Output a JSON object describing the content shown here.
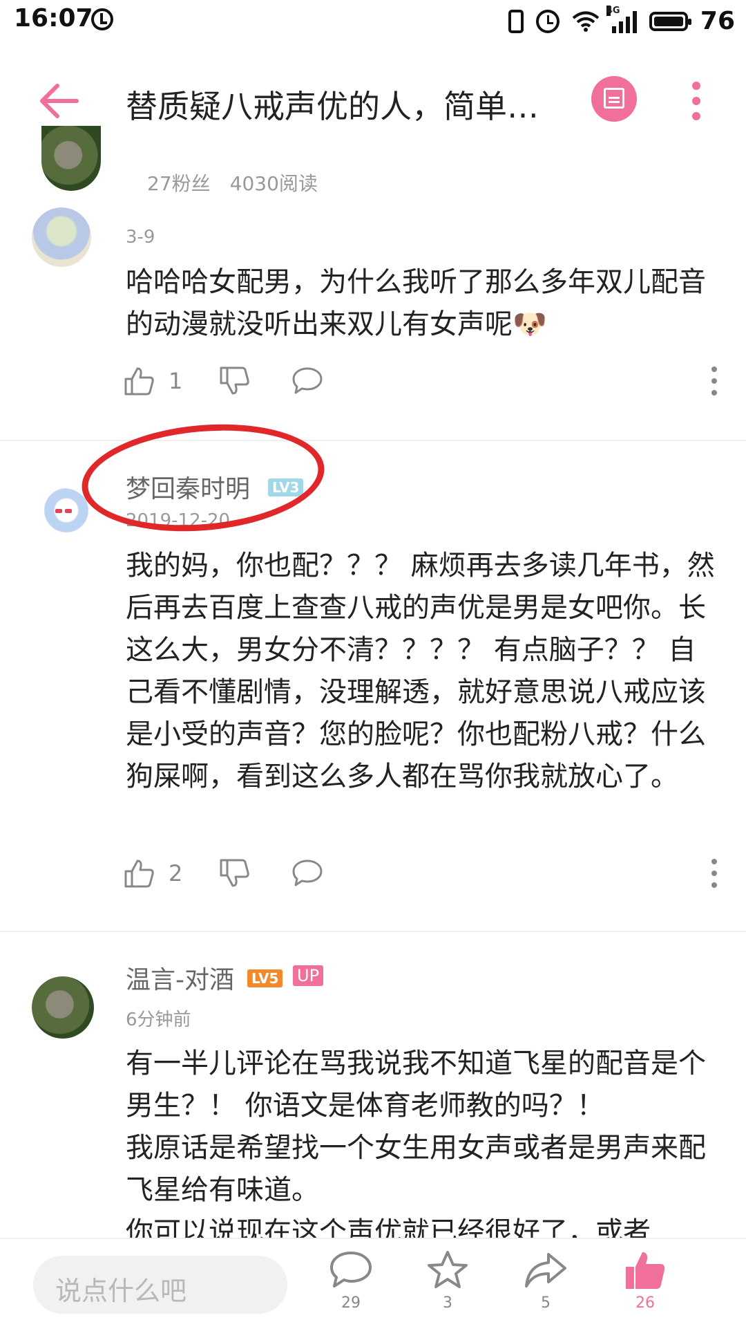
{
  "status_bar": {
    "time": "16:07",
    "network": "4G",
    "battery": "76"
  },
  "header": {
    "title": "替质疑八戒声优的人，简单…"
  },
  "author_info": {
    "fans": "27粉丝",
    "reads": "4030阅读"
  },
  "comments": [
    {
      "date": "3-9",
      "text": "哈哈哈女配男，为什么我听了那么多年双儿配音的动漫就没听出来双儿有女声呢🐶",
      "likes": "1"
    },
    {
      "name": "梦回秦时明",
      "level": "LV3",
      "date": "2019-12-20",
      "text": "我的妈，你也配？？？ 麻烦再去多读几年书，然后再去百度上查查八戒的声优是男是女吧你。长这么大，男女分不清？？？？ 有点脑子？？ 自己看不懂剧情，没理解透，就好意思说八戒应该是小受的声音？您的脸呢？你也配粉八戒？什么狗屎啊，看到这么多人都在骂你我就放心了。",
      "likes": "2"
    },
    {
      "name": "温言-对酒",
      "level": "LV5",
      "tag": "UP",
      "date": "6分钟前",
      "text": "有一半儿评论在骂我说我不知道飞星的配音是个男生？！ 你语文是体育老师教的吗？！\n我原话是希望找一个女生用女声或者是男声来配飞星给有味道。\n你可以说现在这个声优就已经很好了，或者"
    }
  ],
  "bottom_bar": {
    "input_placeholder": "说点什么吧",
    "comments": "29",
    "favorites": "3",
    "shares": "5",
    "likes": "26"
  },
  "colors": {
    "accent": "#f06f9b",
    "annotation_red": "#e0282a"
  }
}
